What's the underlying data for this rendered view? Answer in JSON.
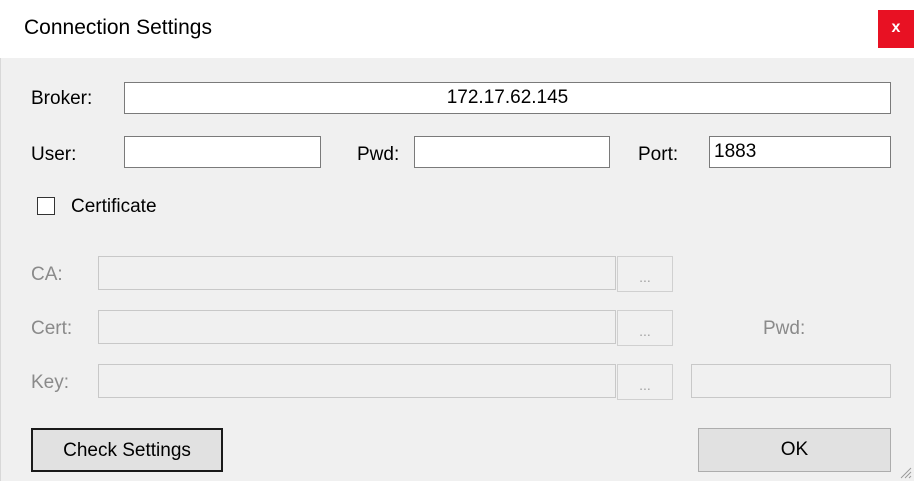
{
  "window": {
    "title": "Connection Settings",
    "close_label": "x"
  },
  "form": {
    "broker_label": "Broker:",
    "broker_value": "172.17.62.145",
    "user_label": "User:",
    "user_value": "",
    "pwd_label": "Pwd:",
    "pwd_value": "",
    "port_label": "Port:",
    "port_value": "1883",
    "certificate_label": "Certificate",
    "certificate_checked": false,
    "ca_label": "CA:",
    "cert_label": "Cert:",
    "key_label": "Key:",
    "key_pwd_label": "Pwd:",
    "browse_label": "..."
  },
  "buttons": {
    "check_settings": "Check Settings",
    "ok": "OK"
  }
}
